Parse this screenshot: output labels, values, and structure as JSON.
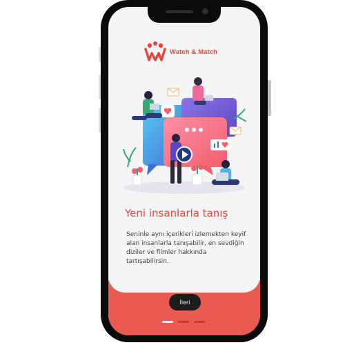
{
  "app": {
    "logo_text": "Watch & Match",
    "brand_color": "#e8443a"
  },
  "onboarding": {
    "title": "Yeni insanlarla tanış",
    "description": "Seninle aynı içerikleri izlemekten keyif alan insanlarla tanışabilir, en sevdiğin diziler ve filmler hakkında tartışabilirsin.",
    "next_label": "İleri",
    "page_indicator": {
      "pages": 3,
      "current": 1
    }
  },
  "icons": {
    "logo": "people-logo-icon",
    "illustration": "people-chatting-illustration"
  },
  "colors": {
    "accent": "#e8443a",
    "bottom_panel": "#eb5a50",
    "button": "#1c1c1c",
    "screen_bg": "#f5f5f7"
  }
}
